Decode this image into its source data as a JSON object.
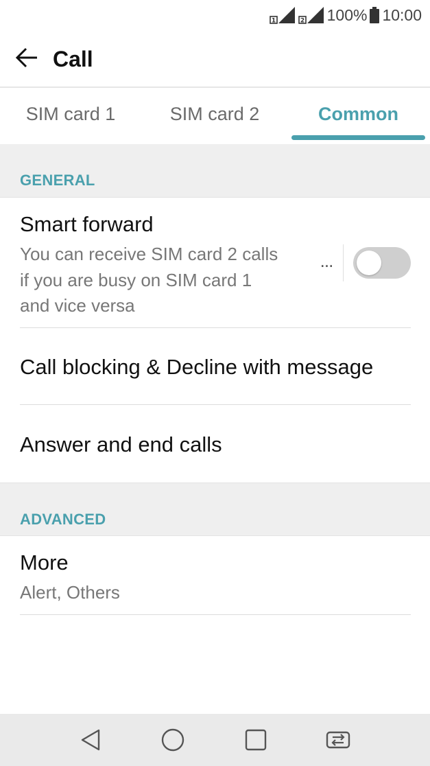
{
  "status_bar": {
    "battery_text": "100%",
    "time": "10:00",
    "sim1_badge": "1",
    "sim2_badge": "2",
    "icons": [
      "sim1-signal-icon",
      "sim2-signal-icon",
      "battery-icon"
    ]
  },
  "app_bar": {
    "title": "Call",
    "back_icon": "arrow-back-icon"
  },
  "tabs": [
    {
      "label": "SIM card 1",
      "active": false
    },
    {
      "label": "SIM card 2",
      "active": false
    },
    {
      "label": "Common",
      "active": true
    }
  ],
  "sections": {
    "general": {
      "header": "GENERAL",
      "items": [
        {
          "title": "Smart forward",
          "summary_lines": [
            "You can receive SIM card 2 calls",
            "if you are busy on SIM card 1",
            "and vice versa"
          ],
          "toggle_on": false,
          "more_icon": "more-horizontal-icon"
        },
        {
          "title": "Call blocking & Decline with message"
        },
        {
          "title": "Answer and end calls"
        }
      ]
    },
    "advanced": {
      "header": "ADVANCED",
      "items": [
        {
          "title": "More",
          "summary": "Alert, Others"
        }
      ]
    }
  },
  "nav_bar": {
    "icons": [
      "back-triangle-icon",
      "home-circle-icon",
      "recents-square-icon",
      "sim-switch-icon"
    ]
  },
  "colors": {
    "accent": "#4aa0ad",
    "section_bg": "#efefef",
    "nav_bg": "#eaeaea",
    "toggle_off": "#cfcfcf"
  }
}
